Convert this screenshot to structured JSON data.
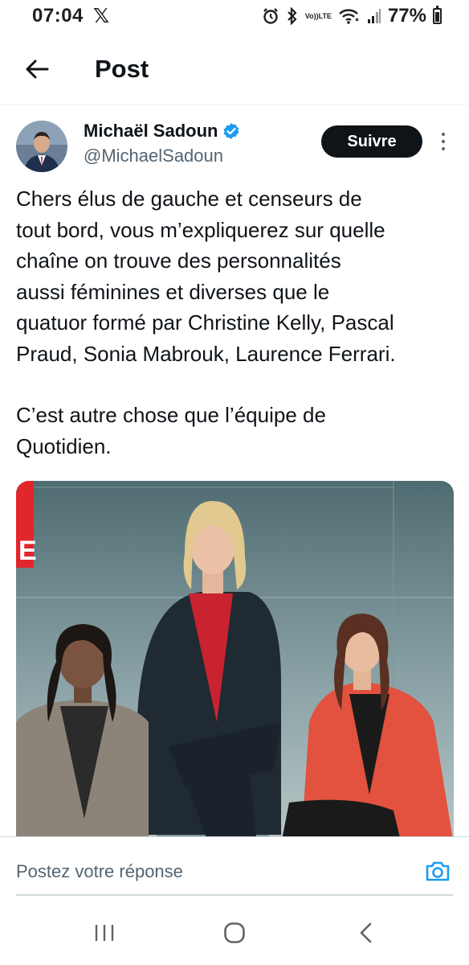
{
  "status_bar": {
    "time": "07:04",
    "notification_icon": "x-logo",
    "lte_top": "Vo))",
    "lte_bottom": "LTE",
    "battery_percent": "77%"
  },
  "header": {
    "title": "Post",
    "back_icon": "arrow-left-icon"
  },
  "tweet": {
    "author_name": "Michaël Sadoun",
    "author_handle": "@MichaelSadoun",
    "verified": true,
    "follow_label": "Suivre",
    "paragraphs": [
      "Chers élus de gauche et censeurs de\ntout bord, vous m’expliquerez sur quelle\nchaîne on trouve des personnalités\naussi féminines et diverses que le\nquatuor formé par Christine Kelly, Pascal\nPraud, Sonia Mabrouk, Laurence Ferrari.",
      "C’est autre chose que l’équipe de\nQuotidien."
    ],
    "media_badge": "E"
  },
  "reply": {
    "placeholder": "Postez votre réponse",
    "camera_icon": "camera-icon"
  },
  "nav": {
    "recents_icon": "recents-icon",
    "home_icon": "home-icon",
    "back_icon": "back-icon"
  },
  "colors": {
    "text_primary": "#0f1419",
    "text_secondary": "#536471",
    "accent_blue": "#1d9bf0",
    "follow_bg": "#0f1419"
  }
}
